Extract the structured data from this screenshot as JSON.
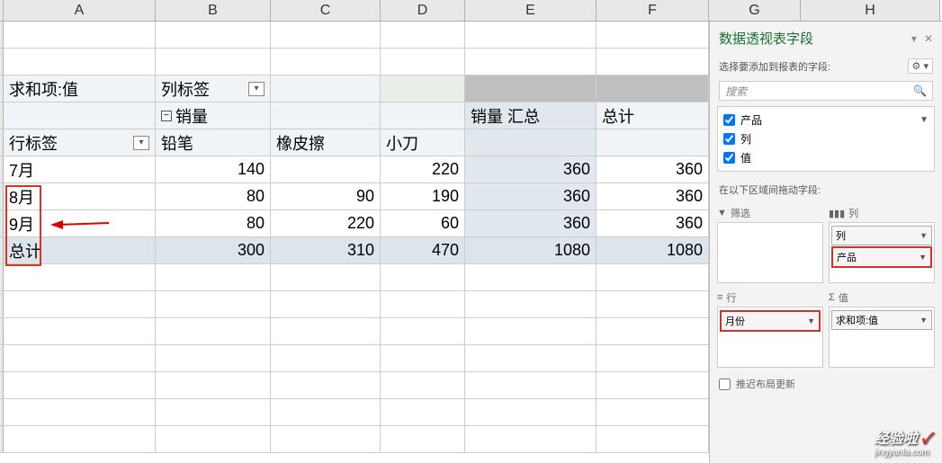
{
  "columns": [
    "A",
    "B",
    "C",
    "D",
    "E",
    "F",
    "G",
    "H"
  ],
  "pivot": {
    "sum_label": "求和项:值",
    "col_labels": "列标签",
    "row_labels": "行标签",
    "sales_label": "销量",
    "sales_total": "销量 汇总",
    "grand_total_col": "总计",
    "grand_total_row": "总计",
    "products": [
      "铅笔",
      "橡皮擦",
      "小刀"
    ],
    "months": [
      "7月",
      "8月",
      "9月"
    ],
    "data": [
      {
        "month": "7月",
        "vals": [
          "140",
          "",
          "220"
        ],
        "subtotal": "360",
        "total": "360"
      },
      {
        "month": "8月",
        "vals": [
          "80",
          "90",
          "190"
        ],
        "subtotal": "360",
        "total": "360"
      },
      {
        "month": "9月",
        "vals": [
          "80",
          "220",
          "60"
        ],
        "subtotal": "360",
        "total": "360"
      }
    ],
    "grand": {
      "vals": [
        "300",
        "310",
        "470"
      ],
      "subtotal": "1080",
      "total": "1080"
    }
  },
  "panel": {
    "title": "数据透视表字段",
    "choose_label": "选择要添加到报表的字段:",
    "search_placeholder": "搜索",
    "fields": [
      {
        "name": "产品",
        "checked": true,
        "arrow": true
      },
      {
        "name": "列",
        "checked": true,
        "arrow": false
      },
      {
        "name": "值",
        "checked": true,
        "arrow": false
      }
    ],
    "drag_hint": "在以下区域间拖动字段:",
    "areas": {
      "filter_label": "筛选",
      "column_label": "列",
      "row_label": "行",
      "value_label": "值",
      "columns": [
        "列",
        "产品"
      ],
      "rows": [
        "月份"
      ],
      "values": [
        "求和项:值"
      ]
    },
    "defer_label": "推迟布局更新"
  },
  "watermark": {
    "text": "经验啦",
    "url": "jingyanla.com"
  }
}
